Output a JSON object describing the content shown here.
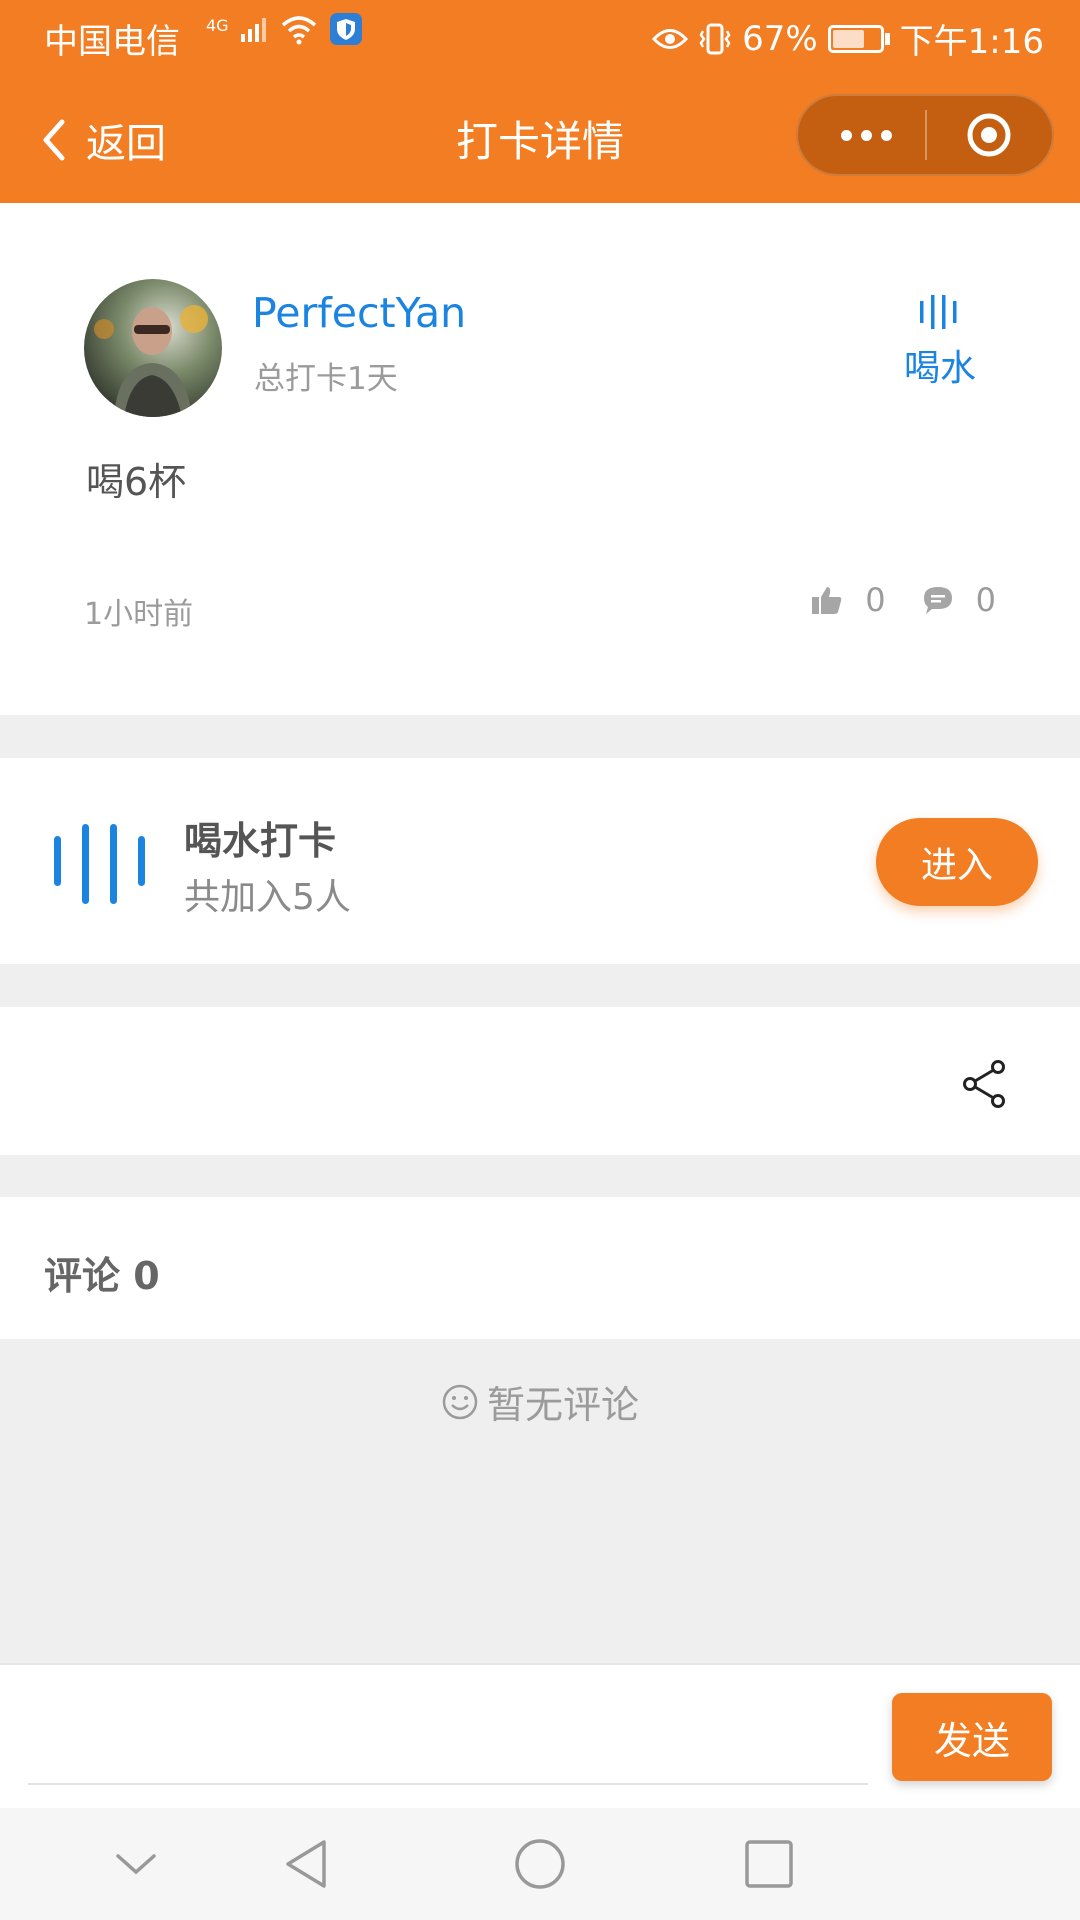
{
  "status_bar": {
    "carrier": "中国电信",
    "network": "4G",
    "battery": "67%",
    "battery_level": 0.67,
    "time": "下午1:16"
  },
  "nav": {
    "back_label": "返回",
    "title": "打卡详情"
  },
  "post": {
    "username": "PerfectYan",
    "total_checkin": "总打卡1天",
    "tag_label": "喝水",
    "content": "喝6杯",
    "time_ago": "1小时前",
    "likes": "0",
    "comments": "0"
  },
  "group": {
    "name": "喝水打卡",
    "members": "共加入5人",
    "enter_label": "进入"
  },
  "comments_section": {
    "title": "评论 0",
    "empty_text": "暂无评论"
  },
  "input": {
    "placeholder": "",
    "send_label": "发送"
  },
  "colors": {
    "primary_orange": "#f37d22",
    "accent_blue": "#1a84e0"
  },
  "icons": {
    "back": "chevron-left-icon",
    "more": "more-dots-icon",
    "close": "target-circle-icon",
    "category": "water-bars-icon",
    "like": "thumbs-up-icon",
    "comment": "speech-bubble-icon",
    "share": "share-icon",
    "empty": "smile-icon"
  }
}
